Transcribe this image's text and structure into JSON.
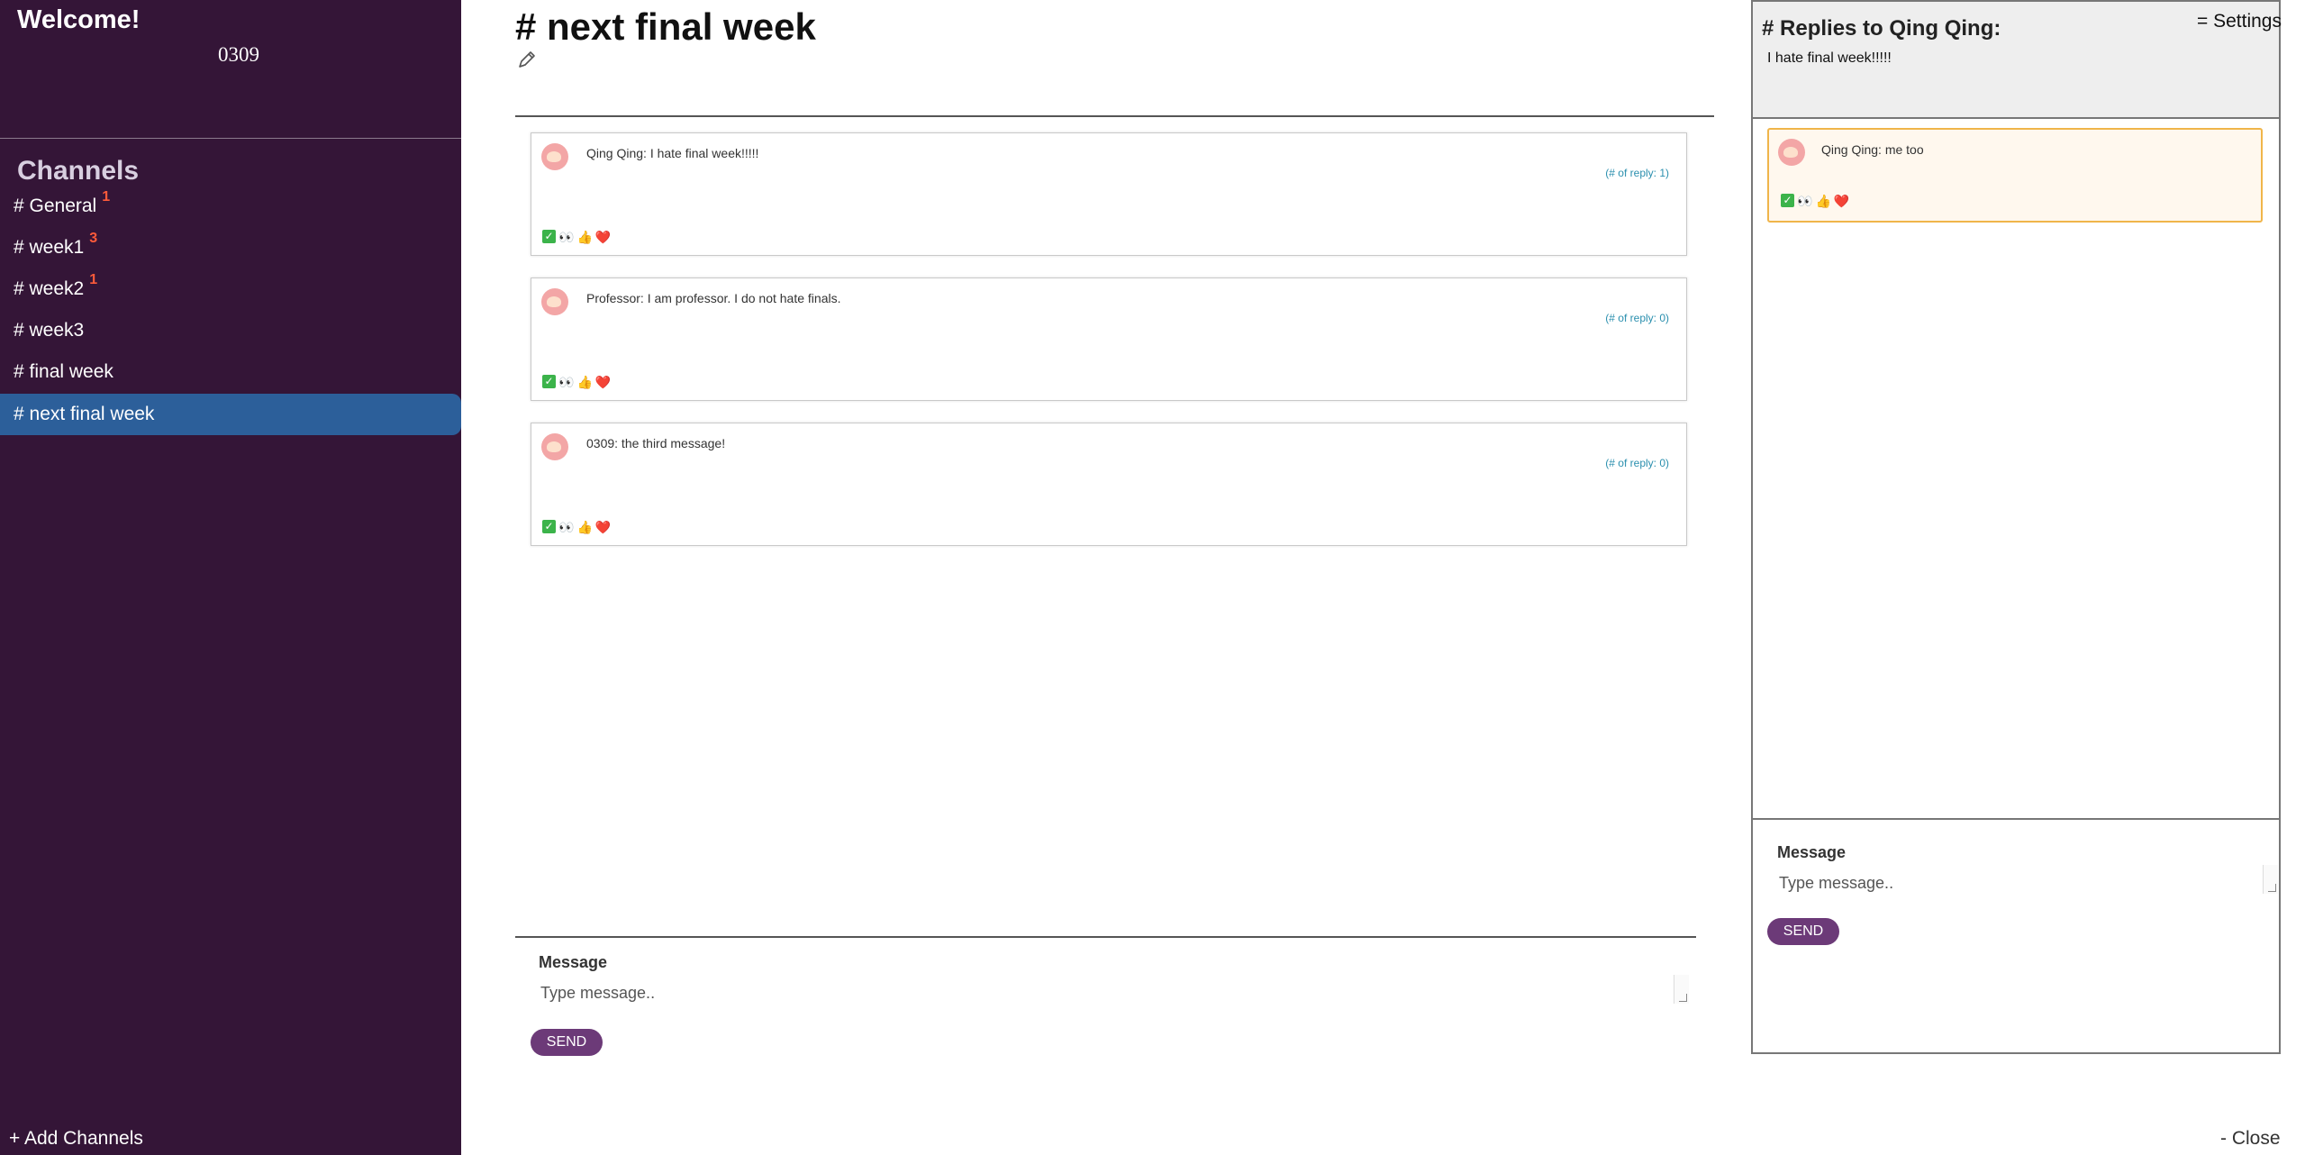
{
  "sidebar": {
    "welcome": "Welcome!",
    "username": "0309",
    "channels_title": "Channels",
    "channels": [
      {
        "label": "# General",
        "badge": "1"
      },
      {
        "label": "# week1",
        "badge": "3"
      },
      {
        "label": "# week2",
        "badge": "1"
      },
      {
        "label": "# week3",
        "badge": ""
      },
      {
        "label": "# final week",
        "badge": ""
      },
      {
        "label": "# next final week",
        "badge": "",
        "active": true
      }
    ],
    "add_channels": "+ Add Channels"
  },
  "main": {
    "title": "# next final week",
    "messages": [
      {
        "text": "Qing Qing: I hate final week!!!!!",
        "replies": "(# of reply: 1)"
      },
      {
        "text": "Professor: I am professor. I do not hate finals.",
        "replies": "(# of reply: 0)"
      },
      {
        "text": "0309: the third message!",
        "replies": "(# of reply: 0)"
      }
    ],
    "reactions": [
      "✅",
      "👀",
      "👍",
      "❤️"
    ],
    "composer": {
      "label": "Message",
      "placeholder": "Type message..",
      "send_label": "SEND"
    }
  },
  "thread": {
    "title": "# Replies to Qing Qing:",
    "parent_text": "I hate final week!!!!!",
    "settings_label": "= Settings",
    "replies": [
      {
        "text": "Qing Qing: me too"
      }
    ],
    "composer": {
      "label": "Message",
      "placeholder": "Type message..",
      "send_label": "SEND"
    },
    "close_label": "- Close"
  },
  "colors": {
    "sidebar_bg": "#341537",
    "active_channel": "#2c5f9a",
    "badge": "#ff5a3a",
    "send_button": "#6c3a78",
    "reply_link": "#2a8fae",
    "highlight_border": "#f0b54a"
  },
  "icons": {
    "edit": "pencil-icon",
    "avatar": "user-avatar"
  }
}
